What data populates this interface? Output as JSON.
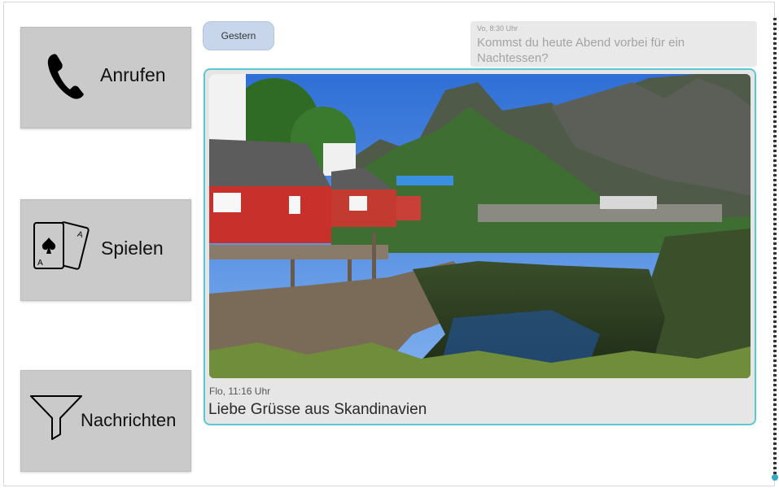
{
  "sidebar": {
    "buttons": [
      {
        "label": "Anrufen",
        "icon": "phone-icon"
      },
      {
        "label": "Spielen",
        "icon": "playing-cards-icon"
      },
      {
        "label": "Nachrichten",
        "icon": "filter-icon"
      }
    ]
  },
  "chat": {
    "date_chip": "Gestern",
    "previous_message": {
      "meta": "Vo, 8:30 Uhr",
      "text": "Kommst du heute Abend vorbei für ein Nachtessen?"
    },
    "selected_message": {
      "meta": "Flo, 11:16 Uhr",
      "text": "Liebe Grüsse aus Skandinavien",
      "image": "landscape-photo"
    }
  },
  "colors": {
    "button_bg": "#cacaca",
    "date_chip_bg": "#c8d6ec",
    "selection_border": "#5ac8d0",
    "message_bg": "#e6e6e6"
  }
}
